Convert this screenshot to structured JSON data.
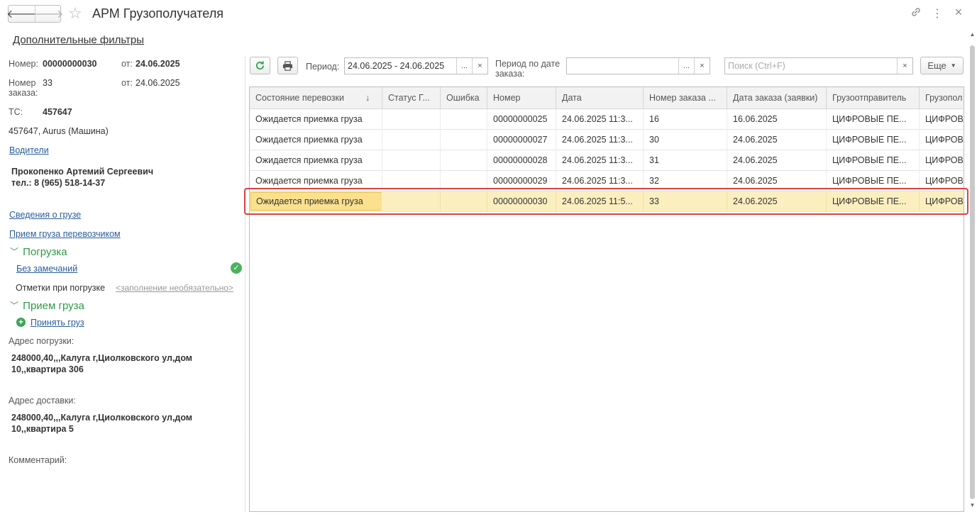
{
  "window": {
    "title": "АРМ Грузополучателя",
    "back_glyph": "🡐",
    "forward_glyph": "🡒",
    "icons": [
      "star-icon",
      "link-icon",
      "more-icon",
      "close-icon"
    ]
  },
  "left": {
    "extra_filters": "Дополнительные фильтры",
    "number_label": "Номер:",
    "number_value": "00000000030",
    "from_label": "от:",
    "from_value": "24.06.2025",
    "order_label": "Номер заказа:",
    "order_value": "33",
    "order_from_label": "от:",
    "order_from_value": "24.06.2025",
    "ts_label": "ТС:",
    "ts_value": "457647",
    "vehicle": "457647, Aurus (Машина)",
    "drivers_link": "Водители",
    "driver_name": "Прокопенко Артемий Сергеевич",
    "driver_phone": "тел.: 8 (965) 518-14-37",
    "cargo_info_link": "Сведения о грузе",
    "carrier_accept_link": "Прием груза перевозчиком",
    "loading_group": "Погрузка",
    "no_remarks_link": "Без замечаний",
    "loading_marks_label": "Отметки при погрузке",
    "loading_marks_hint": "<заполнение необязательно>",
    "accept_group": "Прием груза",
    "accept_link": "Принять груз",
    "load_addr_label": "Адрес погрузки:",
    "load_addr_line1": "248000,40,,,Калуга г,Циолковского ул,дом",
    "load_addr_line2": "10,,квартира 306",
    "deliv_addr_label": "Адрес доставки:",
    "deliv_addr_line1": "248000,40,,,Калуга г,Циолковского ул,дом",
    "deliv_addr_line2": "10,,квартира 5",
    "comment_label": "Комментарий:"
  },
  "toolbar": {
    "period_label": "Период:",
    "period_value": "24.06.2025 - 24.06.2025",
    "order_period_label": "Период по дате заказа:",
    "order_period_value": "",
    "search_placeholder": "Поиск (Ctrl+F)",
    "more_label": "Еще",
    "dots": "...",
    "clear": "×"
  },
  "table": {
    "columns": [
      "Состояние перевозки",
      "Статус Г...",
      "Ошибка",
      "Номер",
      "Дата",
      "Номер заказа ...",
      "Дата заказа (заявки)",
      "Грузоотправитель",
      "Грузопол"
    ],
    "sort_glyph": "↓",
    "rows": [
      [
        "Ожидается приемка груза",
        "",
        "",
        "00000000025",
        "24.06.2025 11:3...",
        "16",
        "16.06.2025",
        "ЦИФРОВЫЕ ПЕ...",
        "ЦИФРОВ"
      ],
      [
        "Ожидается приемка груза",
        "",
        "",
        "00000000027",
        "24.06.2025 11:3...",
        "30",
        "24.06.2025",
        "ЦИФРОВЫЕ ПЕ...",
        "ЦИФРОВ"
      ],
      [
        "Ожидается приемка груза",
        "",
        "",
        "00000000028",
        "24.06.2025 11:3...",
        "31",
        "24.06.2025",
        "ЦИФРОВЫЕ ПЕ...",
        "ЦИФРОВ"
      ],
      [
        "Ожидается приемка груза",
        "",
        "",
        "00000000029",
        "24.06.2025 11:3...",
        "32",
        "24.06.2025",
        "ЦИФРОВЫЕ ПЕ...",
        "ЦИФРОВ"
      ],
      [
        "Ожидается приемка груза",
        "",
        "",
        "00000000030",
        "24.06.2025 11:5...",
        "33",
        "24.06.2025",
        "ЦИФРОВЫЕ ПЕ...",
        "ЦИФРОВ"
      ]
    ],
    "selected_row": 4
  },
  "colors": {
    "accent_green": "#2d9a47",
    "link": "#2a5d9c",
    "selection": "#fcefbf",
    "highlight_border": "#d9433f"
  }
}
